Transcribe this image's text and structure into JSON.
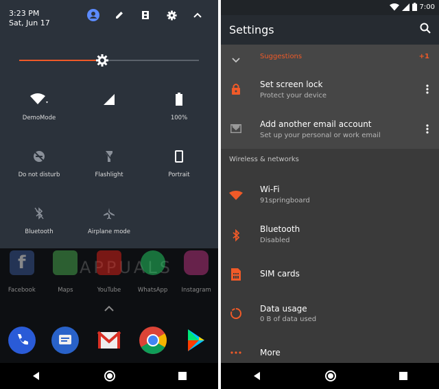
{
  "left": {
    "quick_settings": {
      "time": "3:23 PM",
      "date": "Sat, Jun 17",
      "header_icons": [
        "account-icon",
        "edit-icon",
        "filmstrip-icon",
        "gear-icon",
        "chevron-up-icon"
      ],
      "brightness_level": 0.46,
      "tiles": [
        {
          "label": "DemoMode",
          "icon": "wifi-icon"
        },
        {
          "label": "",
          "icon": "cellular-signal-icon"
        },
        {
          "label": "100%",
          "icon": "battery-icon"
        },
        {
          "label": "Do not disturb",
          "icon": "dnd-off-icon"
        },
        {
          "label": "Flashlight",
          "icon": "flashlight-off-icon"
        },
        {
          "label": "Portrait",
          "icon": "portrait-icon"
        },
        {
          "label": "Bluetooth",
          "icon": "bluetooth-off-icon"
        },
        {
          "label": "Airplane mode",
          "icon": "airplane-off-icon"
        }
      ]
    },
    "home": {
      "watermark": "APPUALS",
      "apps": [
        {
          "label": "Facebook",
          "color": "#3b5998"
        },
        {
          "label": "Maps",
          "color": "#4caf50"
        },
        {
          "label": "YouTube",
          "color": "#e62117"
        },
        {
          "label": "WhatsApp",
          "color": "#25d366"
        },
        {
          "label": "Instagram",
          "color": "#c13584"
        }
      ],
      "dock": [
        "phone-icon",
        "messages-icon",
        "gmail-icon",
        "chrome-icon",
        "play-store-icon"
      ]
    }
  },
  "right": {
    "status": {
      "time": "7:00"
    },
    "appbar": {
      "title": "Settings"
    },
    "suggestions": {
      "label": "Suggestions",
      "count": "+1",
      "items": [
        {
          "title": "Set screen lock",
          "subtitle": "Protect your device",
          "icon": "lock-icon"
        },
        {
          "title": "Add another email account",
          "subtitle": "Set up your personal or work email",
          "icon": "email-icon"
        }
      ]
    },
    "section_title": "Wireless & networks",
    "items": [
      {
        "title": "Wi-Fi",
        "subtitle": "91springboard",
        "icon": "wifi-icon"
      },
      {
        "title": "Bluetooth",
        "subtitle": "Disabled",
        "icon": "bluetooth-icon"
      },
      {
        "title": "SIM cards",
        "subtitle": "",
        "icon": "sim-card-icon"
      },
      {
        "title": "Data usage",
        "subtitle": "0 B of data used",
        "icon": "data-usage-icon"
      },
      {
        "title": "More",
        "subtitle": "",
        "icon": "more-horiz-icon"
      }
    ],
    "accent": "#f05a28"
  }
}
